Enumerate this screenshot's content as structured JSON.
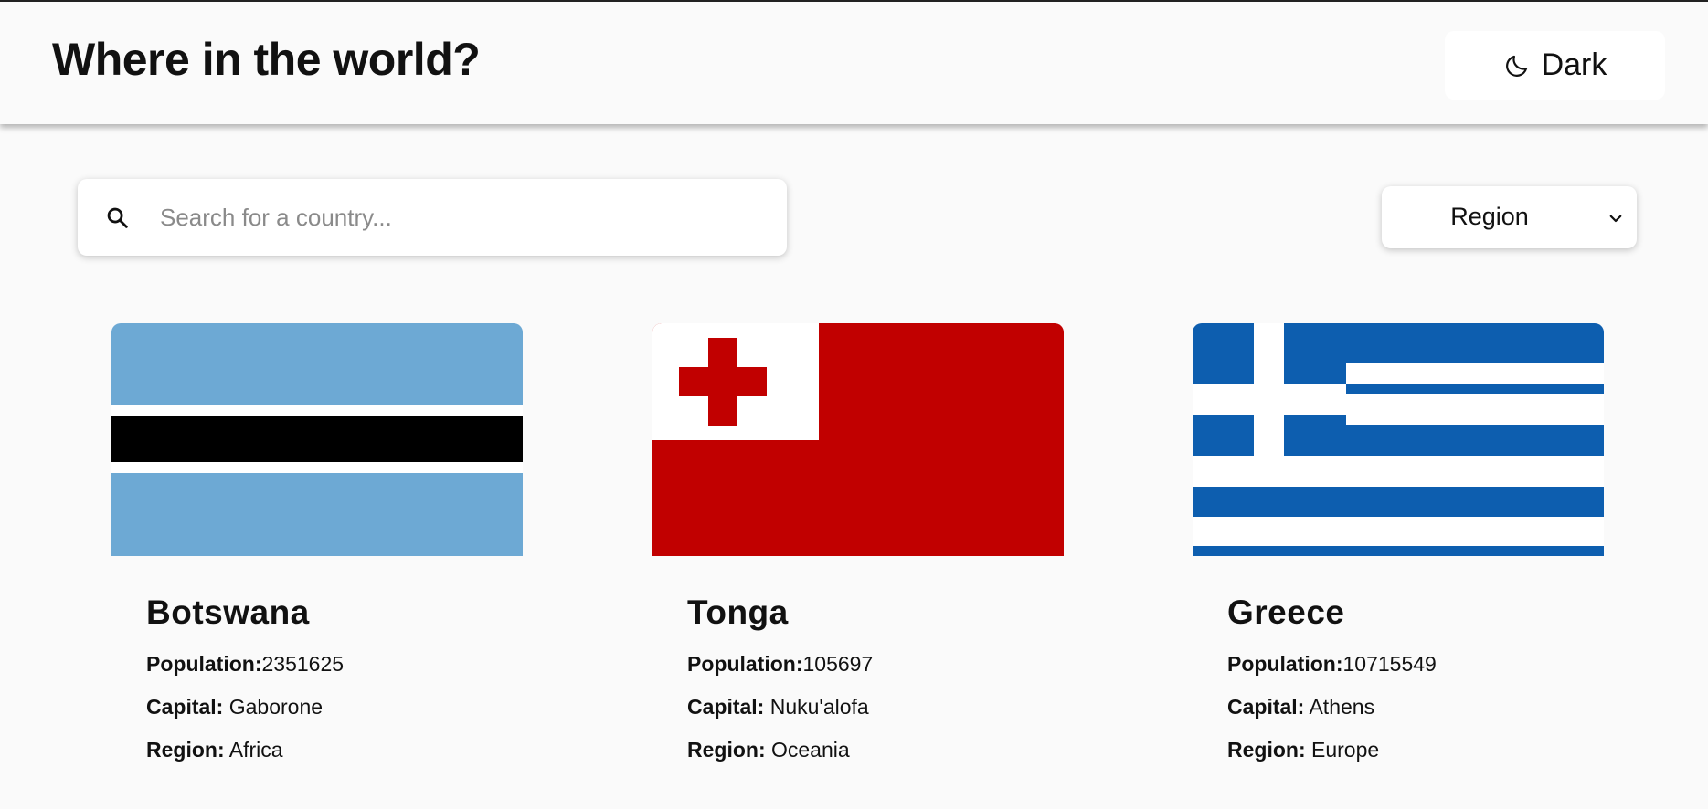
{
  "header": {
    "title": "Where in the world?",
    "mode_toggle": {
      "label": "Dark",
      "icon": "moon-icon"
    }
  },
  "search": {
    "placeholder": "Search for a country...",
    "value": "",
    "icon": "search-icon"
  },
  "region_filter": {
    "selected": "Region",
    "icon": "chevron-down-icon"
  },
  "labels": {
    "population": "Population:",
    "capital": "Capital:",
    "region": "Region:"
  },
  "countries": [
    {
      "name": "Botswana",
      "population": "2351625",
      "capital": "Gaborone",
      "region": "Africa"
    },
    {
      "name": "Tonga",
      "population": "105697",
      "capital": "Nuku'alofa",
      "region": "Oceania"
    },
    {
      "name": "Greece",
      "population": "10715549",
      "capital": "Athens",
      "region": "Europe"
    }
  ],
  "colors": {
    "background": "#fafafa",
    "botswana_blue": "#6da9d4",
    "tonga_red": "#c10000",
    "greece_blue": "#0d5eaf"
  }
}
